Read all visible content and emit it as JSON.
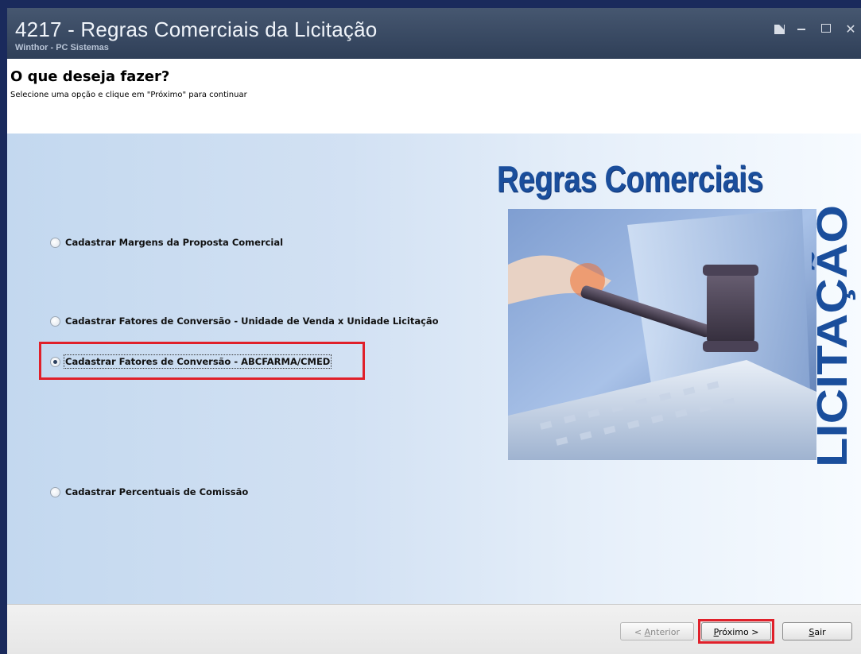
{
  "window": {
    "title": "4217 - Regras Comerciais da Licitação",
    "subtitle": "Winthor - PC Sistemas"
  },
  "header": {
    "title": "O que deseja fazer?",
    "instruction": "Selecione uma opção e clique em \"Próximo\" para continuar"
  },
  "options": [
    {
      "label": "Cadastrar Margens da Proposta Comercial",
      "selected": false
    },
    {
      "label": "Cadastrar Fatores de Conversão - Unidade de Venda x Unidade Licitação",
      "selected": false
    },
    {
      "label": "Cadastrar Fatores de Conversão - ABCFARMA/CMED",
      "selected": true
    },
    {
      "label": "Cadastrar Percentuais de Comissão",
      "selected": false
    }
  ],
  "promo": {
    "title": "Regras Comerciais",
    "vertical_text": "LICITAÇÃO"
  },
  "buttons": {
    "prev": {
      "before": "< ",
      "accel": "A",
      "after": "nterior",
      "enabled": false
    },
    "next": {
      "accel": "P",
      "after": "róximo >",
      "enabled": true
    },
    "exit": {
      "accel": "S",
      "after": "air",
      "enabled": true
    }
  },
  "colors": {
    "highlight": "#e0202a",
    "promo_title": "#1a4e9c",
    "titlebar": "#3a4b66"
  }
}
